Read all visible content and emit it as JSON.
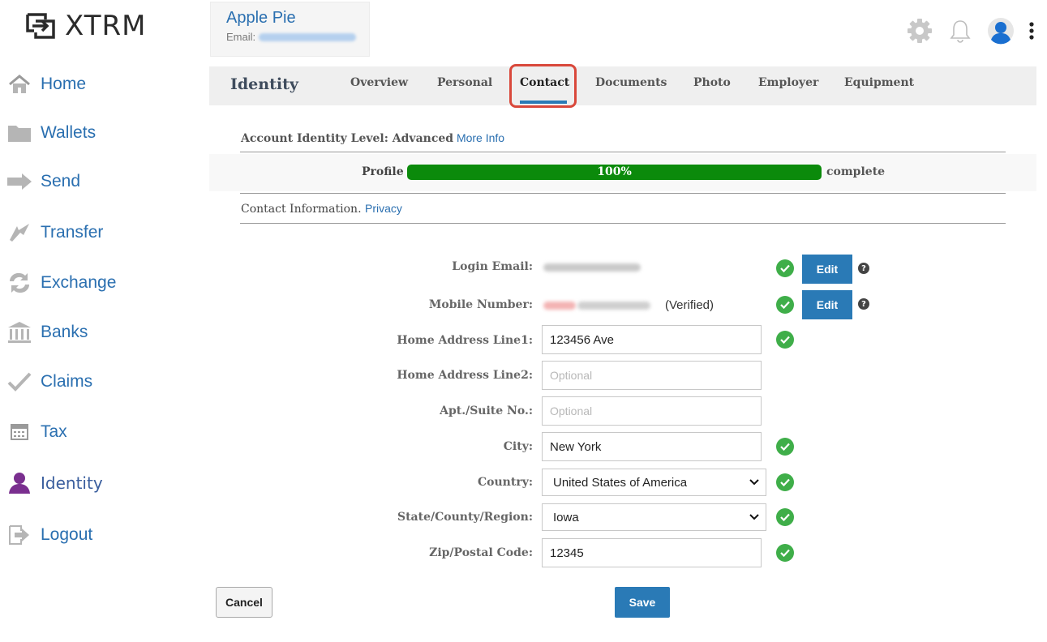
{
  "brand": {
    "logo_text": "XTRM"
  },
  "sidebar": {
    "items": [
      {
        "label": "Home",
        "icon": "home-icon"
      },
      {
        "label": "Wallets",
        "icon": "folder-icon"
      },
      {
        "label": "Send",
        "icon": "arrow-right-icon"
      },
      {
        "label": "Transfer",
        "icon": "transfer-icon"
      },
      {
        "label": "Exchange",
        "icon": "exchange-icon"
      },
      {
        "label": "Banks",
        "icon": "bank-icon"
      },
      {
        "label": "Claims",
        "icon": "checkmark-icon"
      },
      {
        "label": "Tax",
        "icon": "calculator-icon"
      },
      {
        "label": "Identity",
        "icon": "user-icon"
      },
      {
        "label": "Logout",
        "icon": "logout-icon"
      }
    ],
    "active": "Identity"
  },
  "user": {
    "name": "Apple Pie",
    "email_label": "Email:"
  },
  "header_icons": [
    "gear-icon",
    "bell-icon",
    "avatar-icon",
    "more-vertical-icon"
  ],
  "tabs": {
    "title": "Identity",
    "items": [
      {
        "label": "Overview"
      },
      {
        "label": "Personal"
      },
      {
        "label": "Contact"
      },
      {
        "label": "Documents"
      },
      {
        "label": "Photo"
      },
      {
        "label": "Employer"
      },
      {
        "label": "Equipment"
      }
    ],
    "active": "Contact"
  },
  "account_level": {
    "label": "Account Identity Level: Advanced",
    "link": "More Info"
  },
  "profile_progress": {
    "label": "Profile",
    "value": 1.0,
    "text": "100%",
    "suffix": "complete"
  },
  "contact_info": {
    "text": "Contact Information.",
    "link": "Privacy"
  },
  "form": {
    "login_email": {
      "label": "Login Email:",
      "edit_label": "Edit",
      "help": "?"
    },
    "mobile_number": {
      "label": "Mobile Number:",
      "status": "(Verified)",
      "edit_label": "Edit",
      "help": "?"
    },
    "address1": {
      "label": "Home Address Line1:",
      "value": "123456 Ave"
    },
    "address2": {
      "label": "Home Address Line2:",
      "value": "",
      "placeholder": "Optional"
    },
    "apt": {
      "label": "Apt./Suite No.:",
      "value": "",
      "placeholder": "Optional"
    },
    "city": {
      "label": "City:",
      "value": "New York"
    },
    "country": {
      "label": "Country:",
      "value": "United States of America"
    },
    "state": {
      "label": "State/County/Region:",
      "value": "Iowa"
    },
    "zip": {
      "label": "Zip/Postal Code:",
      "value": "12345"
    }
  },
  "actions": {
    "cancel": "Cancel",
    "save": "Save"
  },
  "colors": {
    "accent": "#2a7ab6",
    "success": "#3fae49",
    "progress": "#0b8a0b",
    "highlight": "#d9483b",
    "identity_icon": "#7a2f8f"
  }
}
